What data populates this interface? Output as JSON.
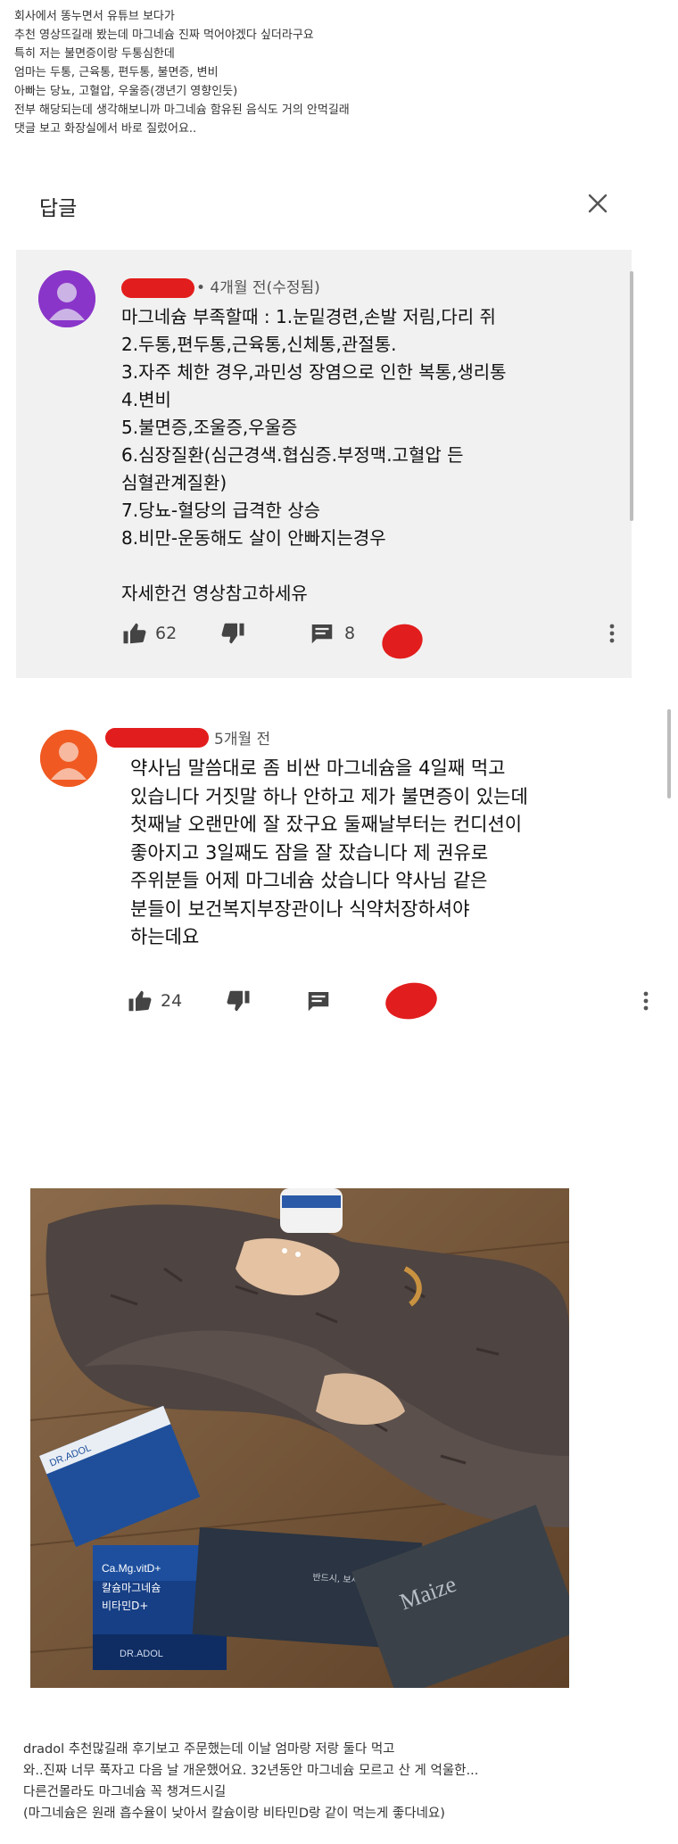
{
  "intro": {
    "lines": [
      "회사에서 똥누면서 유튜브 보다가",
      "추천 영상뜨길래 봤는데 마그네슘 진짜 먹어야겠다 싶더라구요",
      "특히 저는 불면증이랑 두통심한데",
      "엄마는 두통, 근육통, 편두통, 불면증, 변비",
      "아빠는 당뇨, 고혈압, 우울증(갱년기 영향인듯)",
      "전부 해당되는데 생각해보니까 마그네슘 함유된 음식도 거의 안먹길래",
      "댓글 보고 화장실에서 바로 질렀어요.."
    ]
  },
  "reply_panel": {
    "title": "답글",
    "close_icon": "close-icon"
  },
  "comment1": {
    "avatar_color": "#8a35c9",
    "meta": "• 4개월 전(수정됨)",
    "lines": [
      "마그네슘 부족할때 : 1.눈밑경련,손발 저림,다리 쥐",
      "2.두통,편두통,근육통,신체통,관절통.",
      "3.자주 체한 경우,과민성 장염으로 인한 복통,생리통",
      "4.변비",
      "5.불면증,조울증,우울증",
      "6.심장질환(심근경색.협심증.부정맥.고혈압 든",
      "심혈관계질환)",
      "7.당뇨-혈당의 급격한 상승",
      "8.비만-운동해도 살이 안빠지는경우"
    ],
    "closing": "자세한건 영상참고하세유",
    "likes": "62",
    "replies": "8"
  },
  "comment2": {
    "avatar_color": "#f05a22",
    "meta": "5개월 전",
    "lines": [
      "약사님 말씀대로 좀 비싼 마그네슘을 4일째 먹고",
      "있습니다 거짓말 하나 안하고 제가 불면증이 있는데",
      "첫째날 오랜만에 잘 잤구요 둘째날부터는 컨디션이",
      "좋아지고 3일째도 잠을 잘 잤습니다 제 권유로",
      "주위분들 어제 마그네슘 샀습니다 약사님 같은",
      "분들이 보건복지부장관이나 식약처장하셔야",
      "하는데요"
    ],
    "likes": "24"
  },
  "photo": {
    "card_text": "반드시, 보세야 합니다.",
    "box_brand": "DR.ADOL",
    "box_label_1": "Ca.Mg.vitD+",
    "box_label_2": "칼슘마그네슘",
    "box_label_3": "비타민D+",
    "pouch_text": "Maize"
  },
  "outro": {
    "lines": [
      "dradol 추천많길래 후기보고 주문했는데 이날 엄마랑 저랑 둘다 먹고",
      "와..진짜 너무 푹자고 다음 날 개운했어요. 32년동안 마그네슘 모르고 산 게 억울한...",
      "다른건몰라도 마그네슘 꼭 챙겨드시길",
      "(마그네슘은 원래 흡수율이 낮아서 칼슘이랑 비타민D랑 같이 먹는게 좋다네요)"
    ]
  },
  "colors": {
    "comment1_bg": "#f1f1f1",
    "redaction": "#e21d1d"
  }
}
